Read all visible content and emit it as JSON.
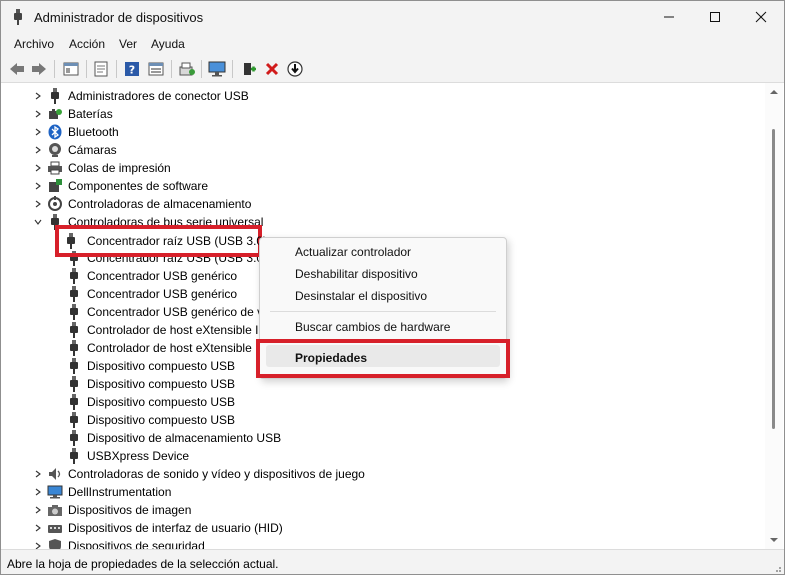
{
  "window": {
    "title": "Administrador de dispositivos"
  },
  "menubar": {
    "items": [
      "Archivo",
      "Acción",
      "Ver",
      "Ayuda"
    ]
  },
  "toolbar": {
    "buttons": [
      "back-arrow-icon",
      "forward-arrow-icon",
      "show-hide-tree-icon",
      "properties-sheet-icon",
      "help-icon",
      "view-icon",
      "scan-hardware-icon",
      "monitor-icon",
      "add-driver-icon",
      "uninstall-x-icon",
      "download-driver-icon"
    ]
  },
  "tree": {
    "rows": [
      {
        "label": "Administradores de conector USB",
        "indent": 0,
        "expanded": false,
        "icon": "usb-plug-icon"
      },
      {
        "label": "Baterías",
        "indent": 0,
        "expanded": false,
        "icon": "battery-icon"
      },
      {
        "label": "Bluetooth",
        "indent": 0,
        "expanded": false,
        "icon": "bluetooth-icon"
      },
      {
        "label": "Cámaras",
        "indent": 0,
        "expanded": false,
        "icon": "camera-icon"
      },
      {
        "label": "Colas de impresión",
        "indent": 0,
        "expanded": false,
        "icon": "printer-icon"
      },
      {
        "label": "Componentes de software",
        "indent": 0,
        "expanded": false,
        "icon": "software-component-icon"
      },
      {
        "label": "Controladoras de almacenamiento",
        "indent": 0,
        "expanded": false,
        "icon": "storage-controller-icon"
      },
      {
        "label": "Controladoras de bus serie universal",
        "indent": 0,
        "expanded": true,
        "icon": "usb-plug-icon"
      },
      {
        "label": "Concentrador raíz USB (USB 3.0)",
        "indent": 1,
        "icon": "usb-plug-icon"
      },
      {
        "label": "Concentrador raíz USB (USB 3.0)",
        "indent": 1,
        "icon": "usb-plug-icon"
      },
      {
        "label": "Concentrador USB genérico",
        "indent": 1,
        "icon": "usb-plug-icon"
      },
      {
        "label": "Concentrador USB genérico",
        "indent": 1,
        "icon": "usb-plug-icon"
      },
      {
        "label": "Concentrador USB genérico de v",
        "indent": 1,
        "icon": "usb-plug-icon"
      },
      {
        "label": "Controlador de host eXtensible I",
        "indent": 1,
        "icon": "usb-plug-icon"
      },
      {
        "label": "Controlador de host eXtensible I",
        "indent": 1,
        "icon": "usb-plug-icon"
      },
      {
        "label": "Dispositivo compuesto USB",
        "indent": 1,
        "icon": "usb-plug-icon"
      },
      {
        "label": "Dispositivo compuesto USB",
        "indent": 1,
        "icon": "usb-plug-icon"
      },
      {
        "label": "Dispositivo compuesto USB",
        "indent": 1,
        "icon": "usb-plug-icon"
      },
      {
        "label": "Dispositivo compuesto USB",
        "indent": 1,
        "icon": "usb-plug-icon"
      },
      {
        "label": "Dispositivo de almacenamiento USB",
        "indent": 1,
        "icon": "usb-plug-icon"
      },
      {
        "label": "USBXpress Device",
        "indent": 1,
        "icon": "usb-plug-icon"
      },
      {
        "label": "Controladoras de sonido y vídeo y dispositivos de juego",
        "indent": 0,
        "expanded": false,
        "icon": "speaker-icon"
      },
      {
        "label": "DellInstrumentation",
        "indent": 0,
        "expanded": false,
        "icon": "monitor-icon"
      },
      {
        "label": "Dispositivos de imagen",
        "indent": 0,
        "expanded": false,
        "icon": "imaging-device-icon"
      },
      {
        "label": "Dispositivos de interfaz de usuario (HID)",
        "indent": 0,
        "expanded": false,
        "icon": "hid-icon"
      },
      {
        "label": "Dispositivos de seguridad",
        "indent": 0,
        "expanded": false,
        "icon": "security-icon"
      }
    ]
  },
  "context_menu": {
    "items": [
      "Actualizar controlador",
      "Deshabilitar dispositivo",
      "Desinstalar el dispositivo",
      "Buscar cambios de hardware",
      "Propiedades"
    ]
  },
  "status": {
    "text": "Abre la hoja de propiedades de la selección actual."
  },
  "colors": {
    "highlight_border": "#d7202a"
  }
}
